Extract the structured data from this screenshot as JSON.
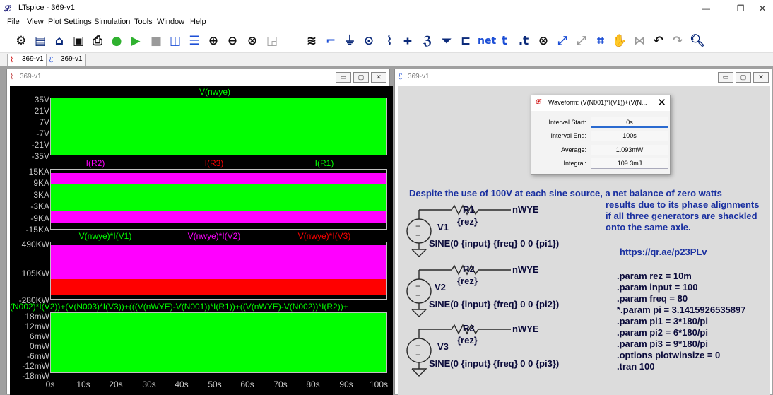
{
  "window": {
    "app_icon": "ltspice-logo-icon",
    "title": "LTspice - 369-v1"
  },
  "menu": [
    "File",
    "View",
    "Plot Settings",
    "Simulation",
    "Tools",
    "Window",
    "Help"
  ],
  "toolbar": {
    "icons": [
      "settings-gear-icon",
      "new-schematic-icon",
      "open-folder-icon",
      "save-icon",
      "print-icon",
      "control-panel-icon",
      "run-icon",
      "halt-icon",
      "tile-vertical-icon",
      "tile-horizontal-icon",
      "zoom-in-icon",
      "zoom-out-icon",
      "zoom-fit-icon",
      "autorange-icon",
      "wire-icon",
      "ground-icon",
      "label-net-icon",
      "resistor-icon",
      "capacitor-icon",
      "inductor-icon",
      "diode-icon",
      "component-icon",
      "net-label-icon",
      "text-icon",
      "spice-directive-icon",
      "delete-icon",
      "duplicate-icon",
      "move-icon",
      "drag-icon",
      "undo-icon",
      "redo-icon",
      "rotate-icon",
      "mirror-icon",
      "find-icon"
    ],
    "net_label": "net",
    "text_label": "t",
    "directive_label": ".t"
  },
  "tabs": [
    {
      "label": "369-v1",
      "icon": "waveform-tab-icon",
      "active": true
    },
    {
      "label": "369-v1",
      "icon": "schematic-tab-icon",
      "active": false
    }
  ],
  "plot_window": {
    "title": "369-v1",
    "panes": [
      {
        "traces": [
          {
            "label": "V(nwye)",
            "color": "#00ff00"
          }
        ],
        "yticks": [
          "35V",
          "21V",
          "7V",
          "-7V",
          "-21V",
          "-35V"
        ]
      },
      {
        "traces": [
          {
            "label": "I(R2)",
            "color": "#ff00ff"
          },
          {
            "label": "I(R3)",
            "color": "#ff0000"
          },
          {
            "label": "I(R1)",
            "color": "#00ff00"
          }
        ],
        "yticks": [
          "15KA",
          "9KA",
          "3KA",
          "-3KA",
          "-9KA",
          "-15KA"
        ]
      },
      {
        "traces": [
          {
            "label": "V(nwye)*I(V1)",
            "color": "#00ff00"
          },
          {
            "label": "V(nwye)*I(V2)",
            "color": "#ff00ff"
          },
          {
            "label": "V(nwye)*I(V3)",
            "color": "#ff0000"
          }
        ],
        "yticks": [
          "490KW",
          "105KW",
          "-280KW"
        ]
      },
      {
        "traces": [
          {
            "label": "(N002)*I(V2))+(V(N003)*I(V3))+(((V(nWYE)-V(N001))*I(R1))+((V(nWYE)-V(N002))*I(R2))+",
            "color": "#00ff00"
          }
        ],
        "yticks": [
          "18mW",
          "12mW",
          "6mW",
          "0mW",
          "-6mW",
          "-12mW",
          "-18mW"
        ]
      }
    ],
    "xticks": [
      "0s",
      "10s",
      "20s",
      "30s",
      "40s",
      "50s",
      "60s",
      "70s",
      "80s",
      "90s",
      "100s"
    ],
    "colors": {
      "green": "#00ff00",
      "magenta": "#ff00ff",
      "red": "#ff0000",
      "background": "#000000"
    }
  },
  "schematic_window": {
    "title": "369-v1",
    "note": [
      "Despite the use of 100V at each sine source, a net balance of zero watts",
      "results due to its phase alignments",
      "if all three generators are shackled",
      "onto the same axle."
    ],
    "url": "https://qr.ae/p23PLv",
    "circuits": [
      {
        "resistor": "R1",
        "value": "{rez}",
        "source": "V1",
        "net": "nWYE",
        "sine": "SINE(0 {input} {freq} 0 0 {pi1})"
      },
      {
        "resistor": "R2",
        "value": "{rez}",
        "source": "V2",
        "net": "nWYE",
        "sine": "SINE(0 {input} {freq} 0 0 {pi2})"
      },
      {
        "resistor": "R3",
        "value": "{rez}",
        "source": "V3",
        "net": "nWYE",
        "sine": "SINE(0 {input} {freq} 0 0 {pi3})"
      }
    ],
    "directives": [
      ".param rez = 10m",
      ".param input = 100",
      ".param freq = 80",
      "*.param pi = 3.1415926535897",
      ".param pi1 = 3*180/pi",
      ".param pi2 = 6*180/pi",
      ".param pi3 = 9*180/pi",
      ".options plotwinsize = 0",
      ".tran 100"
    ]
  },
  "waveform_dialog": {
    "title": "Waveform: (V(N001)*I(V1))+(V(N...",
    "fields": [
      {
        "label": "Interval Start:",
        "value": "0s"
      },
      {
        "label": "Interval End:",
        "value": "100s"
      },
      {
        "label": "Average:",
        "value": "1.093mW"
      },
      {
        "label": "Integral:",
        "value": "109.3mJ"
      }
    ]
  }
}
